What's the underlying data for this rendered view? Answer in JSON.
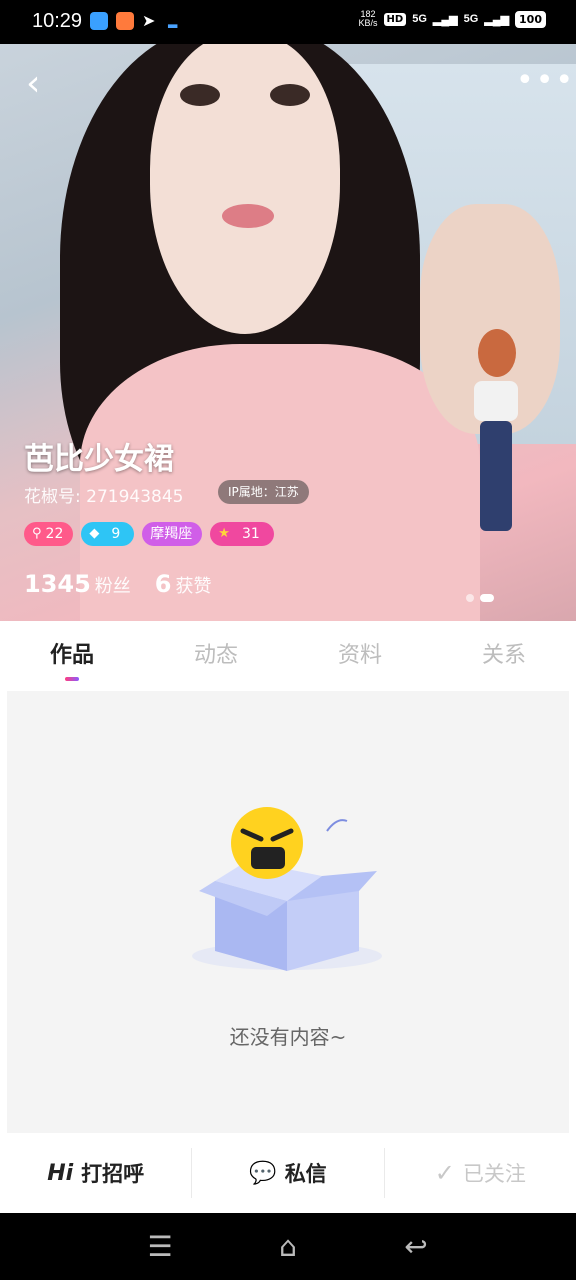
{
  "status": {
    "time": "10:29",
    "net_speed_value": "182",
    "net_speed_unit": "KB/s",
    "hd": "HD",
    "sig1": "5G",
    "sig2": "5G",
    "battery": "100"
  },
  "profile": {
    "nickname": "芭比少女裙",
    "uid": "花椒号: 271943845",
    "ip": "IP属地：江苏",
    "badges": [
      {
        "icon": "level-icon",
        "label": "22",
        "color": "#ff5a8a"
      },
      {
        "icon": "diamond-icon",
        "label": "9",
        "color": "#2ec5f5"
      },
      {
        "icon": "zodiac-icon",
        "label": "摩羯座",
        "color": "#d05ee8"
      },
      {
        "icon": "star-icon",
        "label": "31",
        "color": "#f0489f"
      }
    ],
    "followers": "1345",
    "followers_label": "粉丝",
    "likes": "6",
    "likes_label": "获赞"
  },
  "tabs": [
    "作品",
    "动态",
    "资料",
    "关系"
  ],
  "active_tab": 0,
  "empty": {
    "text": "还没有内容~"
  },
  "actions": {
    "hi_icon": "Hi",
    "greet": "打招呼",
    "message": "私信",
    "followed": "已关注"
  }
}
